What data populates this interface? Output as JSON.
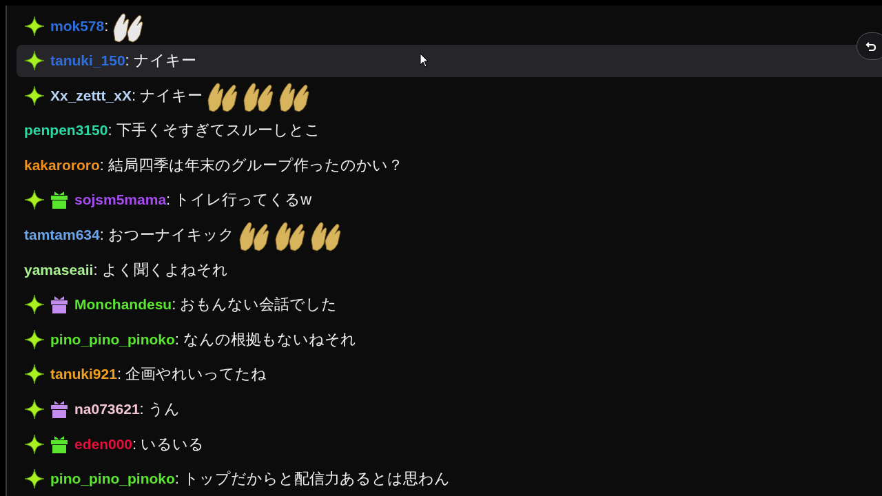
{
  "messages": [
    {
      "user": "mok578",
      "color": "#2e6fe0",
      "badges": [
        {
          "kind": "sparkle"
        }
      ],
      "text": ":",
      "emotes": [
        {
          "kind": "clap",
          "color": "#e8e8e8"
        }
      ],
      "hovered": false
    },
    {
      "user": "tanuki_150",
      "color": "#2e6fe0",
      "badges": [
        {
          "kind": "sparkle"
        }
      ],
      "text": ": ナイキー",
      "hovered": true
    },
    {
      "user": "Xx_zettt_xX",
      "color": "#b9d3f5",
      "badges": [
        {
          "kind": "sparkle"
        }
      ],
      "text": ": ナイキー",
      "emotes": [
        {
          "kind": "clap",
          "color": "#d8b45c"
        },
        {
          "kind": "clap",
          "color": "#d8b45c"
        },
        {
          "kind": "clap",
          "color": "#d8b45c"
        }
      ],
      "hovered": false
    },
    {
      "user": "penpen3150",
      "color": "#2ed8a3",
      "text": ": 下手くそすぎてスルーしとこ",
      "hovered": false
    },
    {
      "user": "kakarororo",
      "color": "#f0901a",
      "text": ": 結局四季は年末のグループ作ったのかい？",
      "hovered": false
    },
    {
      "user": "sojsm5mama",
      "color": "#a64cf0",
      "badges": [
        {
          "kind": "sparkle"
        },
        {
          "kind": "gift",
          "color": "#5ae62e"
        }
      ],
      "text": ": トイレ行ってくるw",
      "hovered": false
    },
    {
      "user": "tamtam634",
      "color": "#6aa3e8",
      "text": ": おつーナイキック",
      "emotes": [
        {
          "kind": "clap",
          "color": "#d8b45c"
        },
        {
          "kind": "clap",
          "color": "#d8b45c"
        },
        {
          "kind": "clap",
          "color": "#d8b45c"
        }
      ],
      "hovered": false
    },
    {
      "user": "yamaseaii",
      "color": "#a8f090",
      "text": ": よく聞くよねそれ",
      "hovered": false
    },
    {
      "user": "Monchandesu",
      "color": "#5ae62e",
      "badges": [
        {
          "kind": "sparkle"
        },
        {
          "kind": "gift",
          "color": "#c58cf0"
        }
      ],
      "text": ": おもんない会話でした",
      "hovered": false
    },
    {
      "user": "pino_pino_pinoko",
      "color": "#5ae62e",
      "badges": [
        {
          "kind": "sparkle"
        }
      ],
      "text": ": なんの根拠もないねそれ",
      "hovered": false
    },
    {
      "user": "tanuki921",
      "color": "#f0a020",
      "badges": [
        {
          "kind": "sparkle"
        }
      ],
      "text": ": 企画やれいってたね",
      "hovered": false
    },
    {
      "user": "na073621",
      "color": "#f3c4d4",
      "badges": [
        {
          "kind": "sparkle"
        },
        {
          "kind": "gift",
          "color": "#c58cf0"
        }
      ],
      "text": ": うん",
      "hovered": false
    },
    {
      "user": "eden000",
      "color": "#e0103a",
      "badges": [
        {
          "kind": "sparkle"
        },
        {
          "kind": "gift",
          "color": "#5ae62e"
        }
      ],
      "text": ": いるいる",
      "hovered": false
    },
    {
      "user": "pino_pino_pinoko",
      "color": "#5ae62e",
      "badges": [
        {
          "kind": "sparkle"
        }
      ],
      "text": ": トップだからと配信力あるとは思わん",
      "hovered": false
    }
  ]
}
